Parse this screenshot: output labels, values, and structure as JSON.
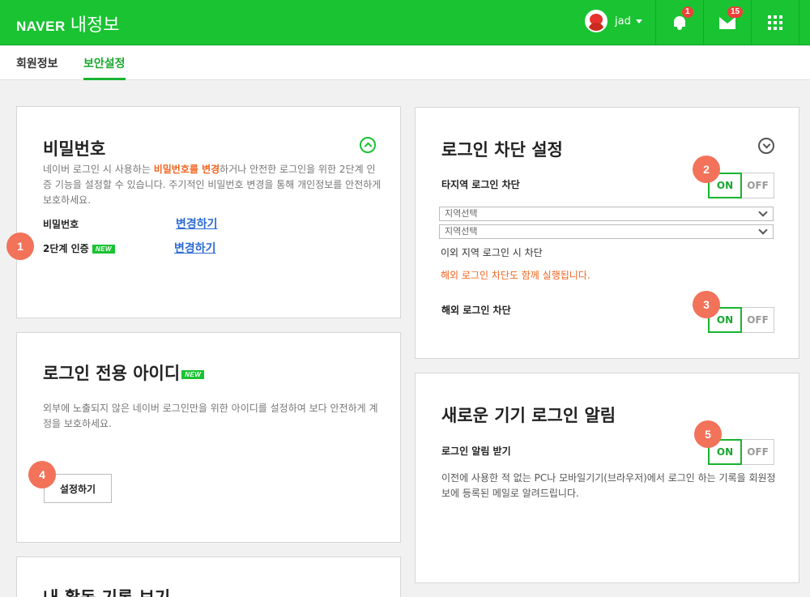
{
  "header": {
    "brand_logo": "NAVER",
    "brand_title": "내정보",
    "username": "jad",
    "notification_count": "1",
    "mail_count": "15"
  },
  "tabs": [
    {
      "label": "회원정보"
    },
    {
      "label": "보안설정"
    }
  ],
  "password_card": {
    "title": "비밀번호",
    "desc_part1": "네이버 로그인 시 사용하는 ",
    "desc_highlight": "비밀번호를 변경",
    "desc_part2": "하거나 안전한 로그인을 위한 2단계 인증 기능을 설정할 수 있습니다. 주기적인 비밀번호 변경을 통해 개인정보를 안전하게 보호하세요.",
    "row1_label": "비밀번호",
    "row1_link": "변경하기",
    "row2_label": "2단계 인증",
    "row2_badge": "NEW",
    "row2_link": "변경하기"
  },
  "login_id_card": {
    "title": "로그인 전용 아이디",
    "badge": "NEW",
    "desc": "외부에 노출되지 않은 네이버 로그인만을 위한 아이디를 설정하여 보다 안전하게 계정을 보호하세요.",
    "button": "설정하기"
  },
  "activity_card": {
    "title": "내 활동 기록 보기"
  },
  "block_card": {
    "title": "로그인 차단 설정",
    "row1_label": "타지역 로그인 차단",
    "select1": "지역선택",
    "select2": "지역선택",
    "region_note": "이외 지역 로그인 시 차단",
    "overseas_warning": "해외 로그인 차단도 함께 실행됩니다.",
    "row2_label": "해외 로그인 차단"
  },
  "new_device_card": {
    "title": "새로운 기기 로그인 알림",
    "row_label": "로그인 알림 받기",
    "desc": "이전에 사용한 적 없는 PC나 모바일기기(브라우저)에서 로그인 하는 기록을 회원정보에 등록된 메일로 알려드립니다."
  },
  "toggle": {
    "on": "ON",
    "off": "OFF"
  },
  "steps": [
    "1",
    "2",
    "3",
    "4",
    "5"
  ],
  "colors": {
    "brand_green": "#19c332",
    "highlight_orange": "#f26522",
    "link_blue": "#2c6bd3",
    "step_marker": "#f2725a"
  }
}
